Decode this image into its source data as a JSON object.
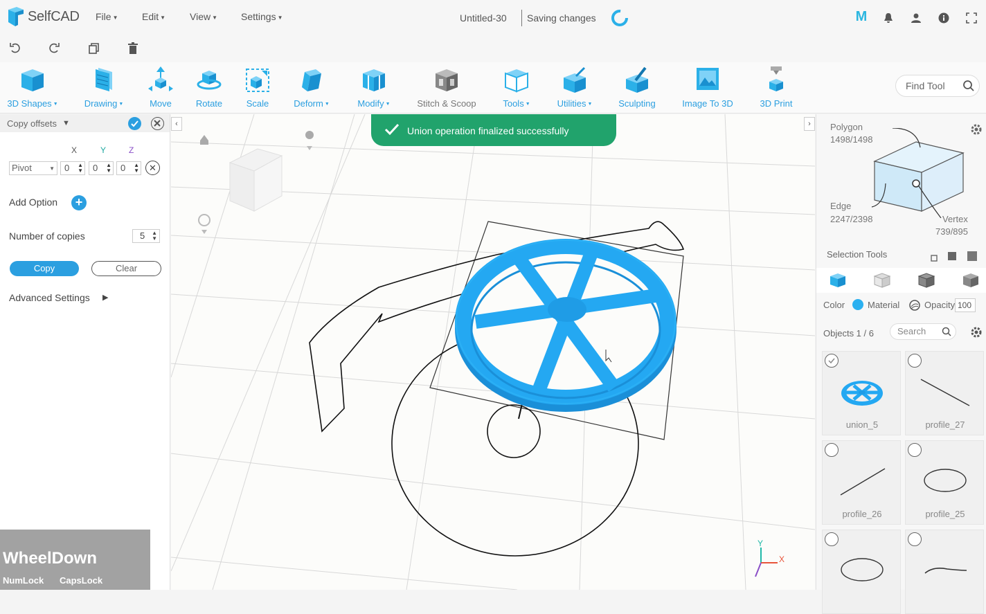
{
  "app": {
    "name": "SelfCAD",
    "menus": [
      "File",
      "Edit",
      "View",
      "Settings"
    ],
    "document_title": "Untitled-30",
    "save_status": "Saving changes",
    "brand_color": "#2b9fe0"
  },
  "toolbar": {
    "tools": [
      {
        "label": "3D Shapes",
        "dropdown": true,
        "icon": "cube-icon"
      },
      {
        "label": "Drawing",
        "dropdown": true,
        "icon": "drawing-icon"
      },
      {
        "label": "Move",
        "dropdown": false,
        "icon": "move-icon"
      },
      {
        "label": "Rotate",
        "dropdown": false,
        "icon": "rotate-icon"
      },
      {
        "label": "Scale",
        "dropdown": false,
        "icon": "scale-icon"
      },
      {
        "label": "Deform",
        "dropdown": true,
        "icon": "deform-icon"
      },
      {
        "label": "Modify",
        "dropdown": true,
        "icon": "modify-icon"
      },
      {
        "label": "Stitch & Scoop",
        "dropdown": false,
        "icon": "stitch-scoop-icon"
      },
      {
        "label": "Tools",
        "dropdown": true,
        "icon": "tools-icon"
      },
      {
        "label": "Utilities",
        "dropdown": true,
        "icon": "utilities-icon"
      },
      {
        "label": "Sculpting",
        "dropdown": false,
        "icon": "sculpting-icon"
      },
      {
        "label": "Image To 3D",
        "dropdown": false,
        "icon": "image-to-3d-icon"
      },
      {
        "label": "3D Print",
        "dropdown": false,
        "icon": "3d-print-icon"
      }
    ],
    "find_tool_placeholder": "Find Tool"
  },
  "left_panel": {
    "title": "Copy offsets",
    "axes": [
      "X",
      "Y",
      "Z"
    ],
    "pivot_value": "Pivot",
    "offsets": [
      "0",
      "0",
      "0"
    ],
    "add_option_label": "Add Option",
    "copies_label": "Number of copies",
    "copies_value": "5",
    "copy_button": "Copy",
    "clear_button": "Clear",
    "advanced_label": "Advanced Settings"
  },
  "toast": {
    "message": "Union operation finalized successfully",
    "color": "#21a36c"
  },
  "right_panel": {
    "polygon_label": "Polygon",
    "polygon_count": "1498/1498",
    "edge_label": "Edge",
    "edge_count": "2247/2398",
    "vertex_label": "Vertex",
    "vertex_count": "739/895",
    "selection_tools_label": "Selection Tools",
    "color_label": "Color",
    "material_label": "Material",
    "opacity_label": "Opacity",
    "opacity_value": "100",
    "objects_label": "Objects 1 / 6",
    "search_placeholder": "Search",
    "objects": [
      {
        "name": "union_5",
        "checked": true
      },
      {
        "name": "profile_27",
        "checked": false
      },
      {
        "name": "profile_26",
        "checked": false
      },
      {
        "name": "profile_25",
        "checked": false
      },
      {
        "name": "",
        "checked": false
      },
      {
        "name": "",
        "checked": false
      }
    ]
  },
  "key_overlay": {
    "main": "WheelDown",
    "num_lock": "NumLock",
    "caps_lock": "CapsLock"
  },
  "axis_gizmo": {
    "x": "X",
    "y": "Y"
  }
}
